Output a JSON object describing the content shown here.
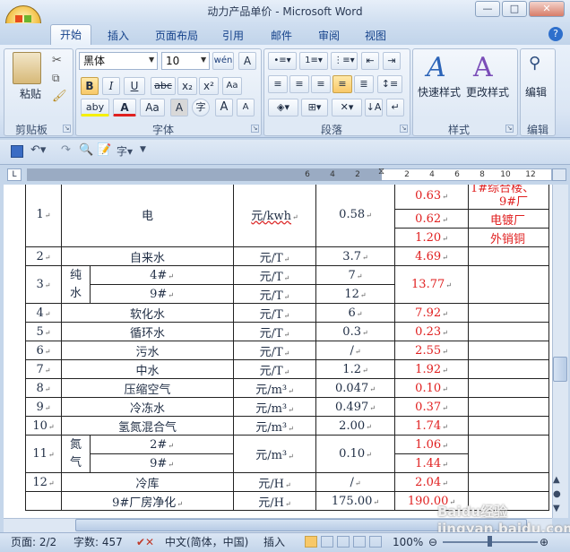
{
  "window": {
    "title": "动力产品单价 - Microsoft Word"
  },
  "tabs": [
    "开始",
    "插入",
    "页面布局",
    "引用",
    "邮件",
    "审阅",
    "视图"
  ],
  "ribbon": {
    "clipboard": {
      "label": "剪贴板",
      "paste": "粘贴"
    },
    "font": {
      "label": "字体",
      "name": "黑体",
      "size": "10",
      "bold": "B",
      "italic": "I",
      "underline": "U",
      "strike": "abc",
      "sub": "x₂",
      "sup": "x²",
      "highlight": "aby",
      "font_color": "A",
      "case": "Aa",
      "char_border": "A",
      "enclose": "字",
      "grow": "A",
      "shrink": "A"
    },
    "paragraph": {
      "label": "段落"
    },
    "styles": {
      "label": "样式",
      "quick": "快速样式",
      "change": "更改样式"
    },
    "editing": {
      "label": "编辑",
      "edit": "编辑"
    }
  },
  "ruler": {
    "ticks": [
      "6",
      "4",
      "2",
      "2",
      "4",
      "6",
      "8",
      "10",
      "12"
    ]
  },
  "table": {
    "rows": [
      {
        "num": "1",
        "name": "电",
        "unit": "元/kwh",
        "price": "0.58",
        "vals": [
          "0.63",
          "0.62",
          "1.20"
        ],
        "notes": [
          "1#综合楼、",
          "9#厂",
          "电镀厂",
          "外销铜"
        ]
      },
      {
        "num": "2",
        "name": "自来水",
        "unit": "元/T",
        "price": "3.7",
        "val": "4.69"
      },
      {
        "num": "3",
        "group": [
          "纯",
          "水"
        ],
        "subs": [
          {
            "name": "4#",
            "unit": "元/T",
            "price": "7"
          },
          {
            "name": "9#",
            "unit": "元/T",
            "price": "12"
          }
        ],
        "val": "13.77"
      },
      {
        "num": "4",
        "name": "软化水",
        "unit": "元/T",
        "price": "6",
        "val": "7.92"
      },
      {
        "num": "5",
        "name": "循环水",
        "unit": "元/T",
        "price": "0.3",
        "val": "0.23"
      },
      {
        "num": "6",
        "name": "污水",
        "unit": "元/T",
        "price": "/",
        "val": "2.55"
      },
      {
        "num": "7",
        "name": "中水",
        "unit": "元/T",
        "price": "1.2",
        "val": "1.92"
      },
      {
        "num": "8",
        "name": "压缩空气",
        "unit": "元/m³",
        "price": "0.047",
        "val": "0.10"
      },
      {
        "num": "9",
        "name": "冷冻水",
        "unit": "元/m³",
        "price": "0.497",
        "val": "0.37"
      },
      {
        "num": "10",
        "name": "氢氮混合气",
        "unit": "元/m³",
        "price": "2.00",
        "val": "1.74"
      },
      {
        "num": "11",
        "group": [
          "氮",
          "气"
        ],
        "subs": [
          {
            "name": "2#",
            "val": "1.06"
          },
          {
            "name": "9#",
            "val": "1.44"
          }
        ],
        "unit": "元/m³",
        "price": "0.10"
      },
      {
        "num": "12",
        "name": "冷库",
        "unit": "元/H",
        "price": "/",
        "val": "2.04"
      },
      {
        "num": "",
        "name": "9#厂房净化",
        "unit": "元/H",
        "price": "175.00",
        "val": "190.00"
      }
    ]
  },
  "status": {
    "page": "页面: 2/2",
    "words": "字数: 457",
    "lang": "中文(简体，中国)",
    "mode": "插入",
    "zoom": "100%"
  },
  "watermark": "Baidu经验 jingyan.baidu.com",
  "colors": {
    "accent": "#15428b",
    "red": "#e02020"
  }
}
